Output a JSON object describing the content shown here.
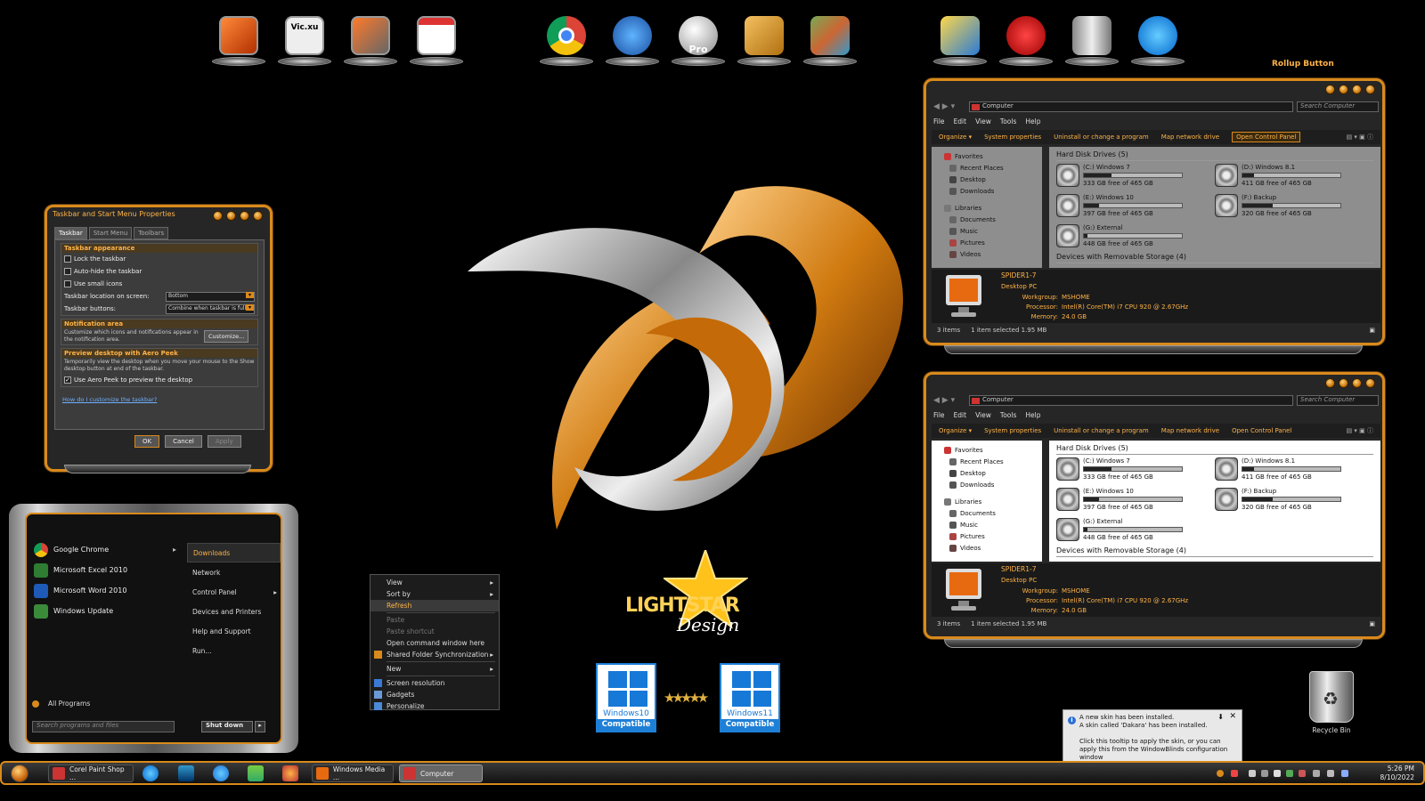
{
  "dock": {
    "tooltip_center_label": "Pro",
    "icons": [
      "computer-icon",
      "vic-xu-icon",
      "satellite-computer-icon",
      "checklist-icon",
      "chrome-icon",
      "thunderbird-icon",
      "google-earth-pro-icon",
      "address-book-icon",
      "map-icon",
      "settings-icon",
      "restore-icon",
      "server-icon",
      "people-icon"
    ],
    "vic_label": "Vic.xu"
  },
  "rollup_label": "Rollup Button",
  "taskbar_props": {
    "title": "Taskbar and Start Menu Properties",
    "tabs": [
      "Taskbar",
      "Start Menu",
      "Toolbars"
    ],
    "appearance_header": "Taskbar appearance",
    "lock": "Lock the taskbar",
    "autohide": "Auto-hide the taskbar",
    "small_icons": "Use small icons",
    "location_label": "Taskbar location on screen:",
    "location_value": "Bottom",
    "buttons_label": "Taskbar buttons:",
    "buttons_value": "Combine when taskbar is full",
    "notif_header": "Notification area",
    "notif_text": "Customize which icons and notifications appear in the notification area.",
    "customize": "Customize...",
    "peek_header": "Preview desktop with Aero Peek",
    "peek_text": "Temporarily view the desktop when you move your mouse to the Show desktop button at end of the taskbar.",
    "peek_check": "Use Aero Peek to preview the desktop",
    "help_link": "How do I customize the taskbar?",
    "ok": "OK",
    "cancel": "Cancel",
    "apply": "Apply"
  },
  "start_menu": {
    "left": [
      {
        "label": "Google Chrome",
        "color": "#e8a020"
      },
      {
        "label": "Microsoft Excel 2010",
        "color": "#2e7d32"
      },
      {
        "label": "Microsoft Word 2010",
        "color": "#1e5bb8"
      },
      {
        "label": "Windows Update",
        "color": "#3a8a3a"
      }
    ],
    "right": [
      "Downloads",
      "Network",
      "Control Panel",
      "Devices and Printers",
      "Help and Support",
      "Run..."
    ],
    "all_programs": "All Programs",
    "search_placeholder": "Search programs and files",
    "shutdown": "Shut down"
  },
  "context_menu": {
    "view": "View",
    "sort": "Sort by",
    "refresh": "Refresh",
    "paste": "Paste",
    "paste_shortcut": "Paste shortcut",
    "cmd": "Open command window here",
    "shared": "Shared Folder Synchronization",
    "new": "New",
    "resolution": "Screen resolution",
    "gadgets": "Gadgets",
    "personalize": "Personalize"
  },
  "brand": {
    "lightstar": "LIGHTSTAR",
    "design": "Design",
    "win10": "Windows10",
    "win11": "Windows11",
    "compatible": "Compatible"
  },
  "explorer": {
    "path": "Computer",
    "search": "Search Computer",
    "menu": [
      "File",
      "Edit",
      "View",
      "Tools",
      "Help"
    ],
    "commands": [
      "Organize ▾",
      "System properties",
      "Uninstall or change a program",
      "Map network drive",
      "Open Control Panel"
    ],
    "nav": {
      "favorites": "Favorites",
      "recent": "Recent Places",
      "desktop": "Desktop",
      "downloads": "Downloads",
      "libraries": "Libraries",
      "documents": "Documents",
      "music": "Music",
      "pictures": "Pictures",
      "videos": "Videos"
    },
    "hdd_header": "Hard Disk Drives (5)",
    "removable_header": "Devices with Removable Storage (4)",
    "drives": [
      {
        "name": "(C:) Windows 7",
        "free": "333 GB free of 465 GB",
        "used_fraction": 0.28
      },
      {
        "name": "(D:) Windows 8.1",
        "free": "411 GB free of 465 GB",
        "used_fraction": 0.12
      },
      {
        "name": "(E:) Windows 10",
        "free": "397 GB free of 465 GB",
        "used_fraction": 0.15
      },
      {
        "name": "(F:) Backup",
        "free": "320 GB free of 465 GB",
        "used_fraction": 0.31
      },
      {
        "name": "(G:) External",
        "free": "448 GB free of 465 GB",
        "used_fraction": 0.04
      }
    ],
    "pc_name": "SPIDER1-7",
    "pc_type": "Desktop PC",
    "workgroup_k": "Workgroup:",
    "workgroup_v": "MSHOME",
    "processor_k": "Processor:",
    "processor_v": "Intel(R) Core(TM) i7 CPU        920  @ 2.67GHz",
    "memory_k": "Memory:",
    "memory_v": "24.0 GB",
    "status_items": "3 items",
    "status_selected": "1 item selected  1.95 MB"
  },
  "recycle_bin": "Recycle Bin",
  "balloon": {
    "title": "A new skin has been installed.",
    "line2": "A skin called 'Dakara' has been installed.",
    "line3": "Click this tooltip to apply the skin, or you can apply this from the WindowBlinds configuration window",
    "close": "✕",
    "pin": "⬇"
  },
  "taskbar": {
    "corel": "Corel Paint Shop ...",
    "media": "Windows Media ...",
    "computer": "Computer",
    "time": "5:26 PM",
    "date": "8/10/2022"
  }
}
